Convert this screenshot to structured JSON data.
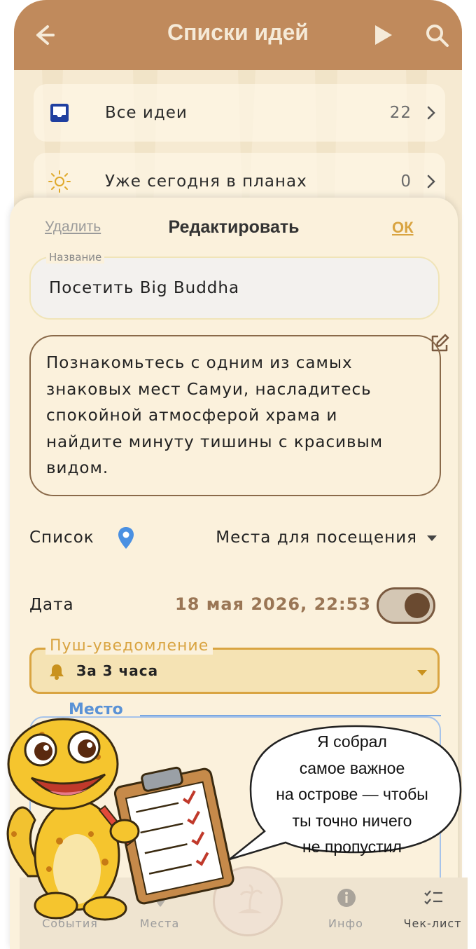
{
  "header": {
    "title": "Списки идей",
    "back_icon": "back-arrow-icon",
    "play_icon": "play-icon",
    "search_icon": "search-icon",
    "color": "#c08a5c"
  },
  "lists": [
    {
      "label": "Все идеи",
      "count": "22",
      "icon": "inbox-icon"
    },
    {
      "label": "Уже сегодня в планах",
      "count": "0",
      "icon": "sun-icon"
    }
  ],
  "sheet": {
    "delete_label": "Удалить",
    "title": "Редактировать",
    "ok_label": "ОК",
    "name_label": "Название",
    "name_value": "Посетить Big Buddha",
    "description_lines": [
      "Познакомьтесь с одним из самых",
      "знаковых мест Самуи, насладитесь",
      "спокойной атмосферой храма и",
      "найдите минуту тишины с красивым",
      "видом."
    ],
    "list_label": "Список",
    "list_value": "Места для посещения",
    "date_label": "Дата",
    "date_value": "18 мая 2026, 22:53",
    "date_toggle_on": true,
    "push_label": "Пуш-уведомление",
    "push_value": "За 3 часа",
    "place_label": "Место"
  },
  "tabbar": {
    "tabs": [
      {
        "label": "События",
        "icon": "events-icon"
      },
      {
        "label": "Места",
        "icon": "map-pin-icon"
      },
      {
        "label": "",
        "icon": "island-icon"
      },
      {
        "label": "Инфо",
        "icon": "info-icon"
      },
      {
        "label": "Чек-лист",
        "icon": "checklist-icon"
      }
    ]
  },
  "bubble": {
    "lines": [
      "Я собрал",
      "самое важное",
      "на острове — чтобы",
      "ты точно ничего",
      "не пропустил"
    ]
  },
  "colors": {
    "accent": "#d9a441",
    "brown": "#9a7655",
    "blue": "#5a92d6"
  }
}
